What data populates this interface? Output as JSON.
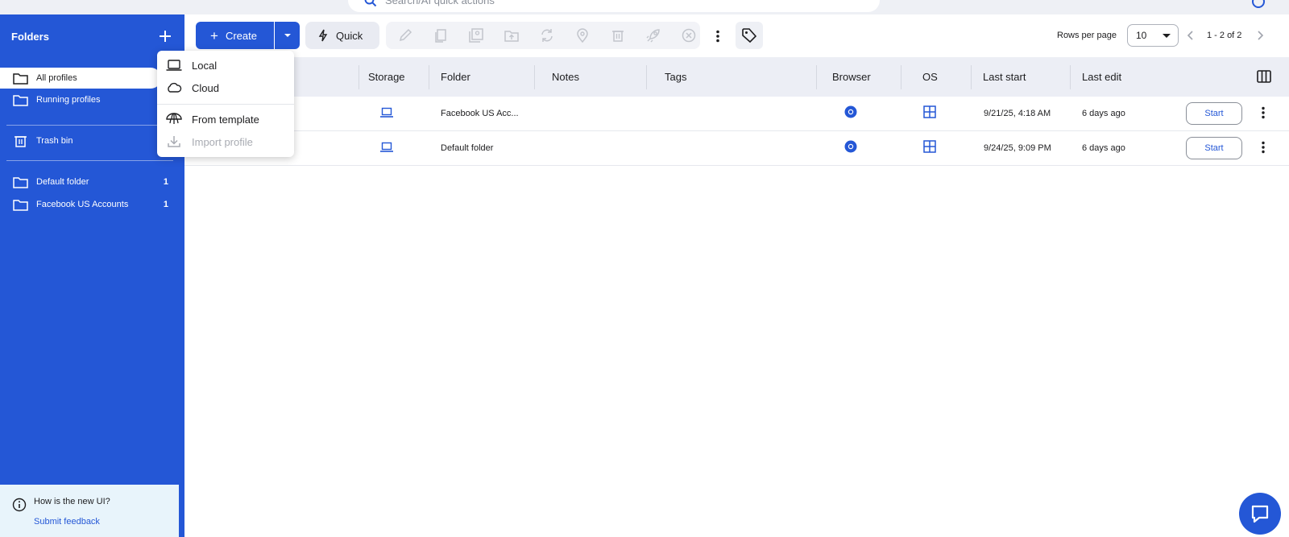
{
  "search": {
    "placeholder": "Search/AI quick actions"
  },
  "sidebar": {
    "title": "Folders",
    "nav": [
      {
        "label": "All profiles"
      },
      {
        "label": "Running profiles"
      },
      {
        "label": "Trash bin"
      }
    ],
    "folders": [
      {
        "label": "Default folder",
        "count": "1"
      },
      {
        "label": "Facebook US Accounts",
        "count": "1"
      }
    ],
    "feedback": {
      "question": "How is the new UI?",
      "link": "Submit feedback"
    }
  },
  "toolbar": {
    "create_label": "Create",
    "quick_label": "Quick",
    "rows_per_page_label": "Rows per page",
    "rows_per_page_value": "10",
    "page_range": "1 - 2 of 2"
  },
  "create_menu": {
    "items": [
      {
        "label": "Local",
        "icon": "laptop-icon",
        "enabled": true
      },
      {
        "label": "Cloud",
        "icon": "cloud-icon",
        "enabled": true
      },
      {
        "label": "From template",
        "icon": "template-icon",
        "enabled": true
      },
      {
        "label": "Import profile",
        "icon": "import-icon",
        "enabled": false
      }
    ]
  },
  "table": {
    "columns": [
      "Storage",
      "Folder",
      "Notes",
      "Tags",
      "Browser",
      "OS",
      "Last start",
      "Last edit"
    ],
    "rows": [
      {
        "folder": "Facebook US Acc...",
        "notes": "",
        "tags": "",
        "browser": "chromium-icon",
        "os": "windows-icon",
        "last_start": "9/21/25, 4:18 AM",
        "last_edit": "6 days ago",
        "action": "Start"
      },
      {
        "folder": "Default folder",
        "notes": "",
        "tags": "",
        "browser": "chromium-icon",
        "os": "windows-icon",
        "last_start": "9/24/25, 9:09 PM",
        "last_edit": "6 days ago",
        "action": "Start"
      }
    ]
  },
  "colors": {
    "brand": "#2457d6",
    "header_bg": "#eceef5",
    "feedback_bg": "#e8f4fb"
  }
}
